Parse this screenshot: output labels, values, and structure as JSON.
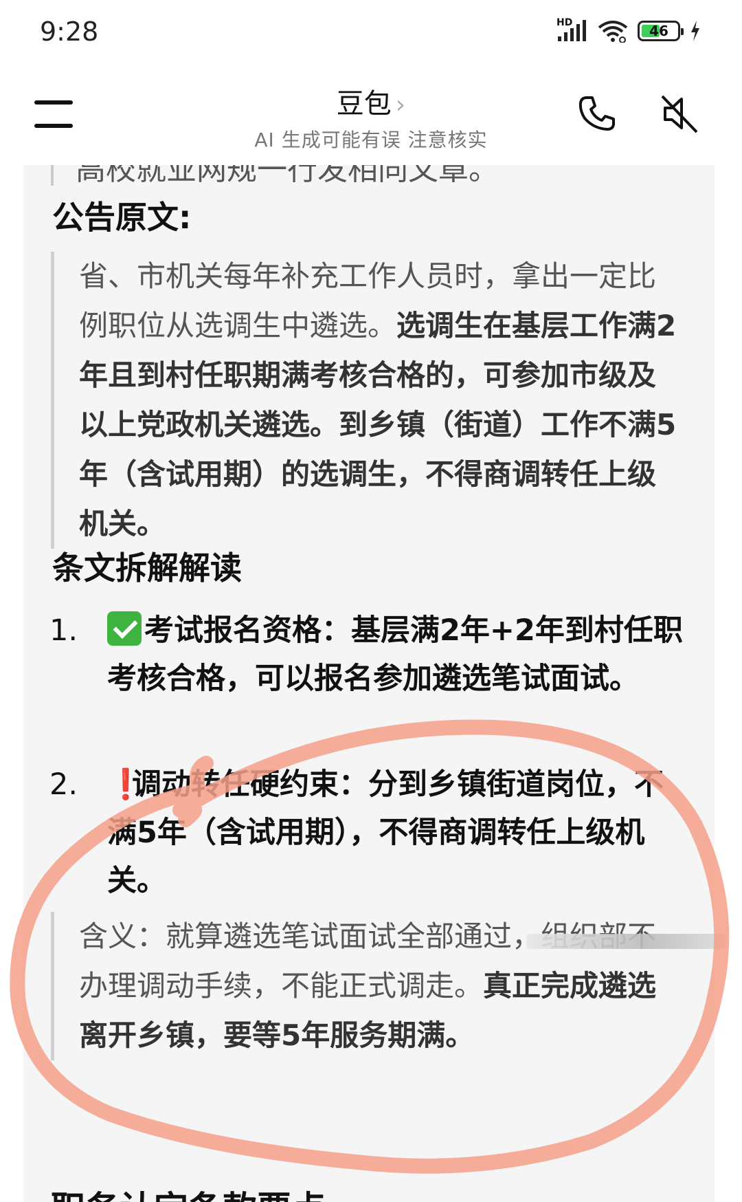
{
  "status_bar": {
    "time": "9:28",
    "network": "HD",
    "battery": "46",
    "icons": [
      "signal-icon",
      "wifi-icon",
      "battery-icon",
      "charging-icon"
    ]
  },
  "header": {
    "title": "豆包",
    "chevron": "›",
    "subtitle": "AI 生成可能有误 注意核实",
    "icons": [
      "menu-icon",
      "phone-icon",
      "mute-icon"
    ]
  },
  "content": {
    "top_cut_text": "高校就业网规一行发相同文章。",
    "section_original_title": "公告原文:",
    "quote_original": {
      "plain_1": "省、市机关每年补充工作人员时，拿出一定比例职位从选调生中遴选。",
      "bold_1": "选调生在基层工作满2年且到村任职期满考核合格的，可参加市级及以上党政机关遴选。到乡镇（街道）工作不满5年（含试用期）的选调生，不得商调转任上级机关。"
    },
    "section_analysis_title": "条文拆解解读",
    "list": [
      {
        "num": "1.",
        "icon": "check-mark-icon",
        "text": "考试报名资格：基层满2年+2年到村任职考核合格，可以报名参加遴选笔试面试。"
      },
      {
        "num": "2.",
        "icon": "exclamation-icon",
        "icon_char": "❗",
        "text": "调动转任硬约束：分到乡镇街道岗位，不满5年（含试用期），不得商调转任上级机关。"
      }
    ],
    "quote_meaning": {
      "plain": "含义：就算遴选笔试面试全部通过，组织部不办理调动手续，不能正式调走。",
      "bold": "真正完成遴选离开乡镇，要等5年服务期满。"
    },
    "bottom_cut_text": "职务认定条款要点"
  },
  "colors": {
    "annotation_circle": "#f4a08a",
    "accent_check": "#3fb33f",
    "accent_exclamation": "#d62424"
  }
}
